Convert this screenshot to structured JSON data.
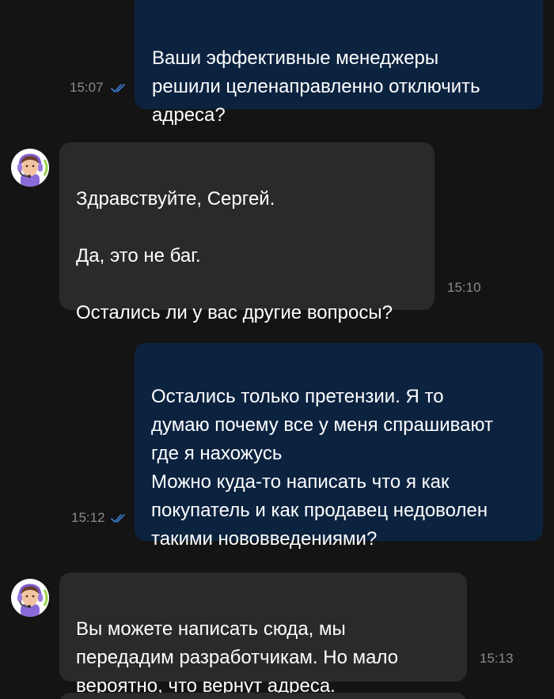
{
  "colors": {
    "background": "#141414",
    "outgoing_bubble": "#0c2340",
    "incoming_bubble": "#2a2a2a",
    "text": "#ffffff",
    "time": "#8a8a8a",
    "read_ticks": "#3d7fd6"
  },
  "messages": [
    {
      "direction": "outgoing",
      "text": "Ваши эффективные менеджеры\nрешили целенаправленно отключить\nадреса?",
      "time": "15:07",
      "status_icon": "double-check-icon"
    },
    {
      "direction": "incoming",
      "avatar_icon": "support-agent-avatar-icon",
      "text": "Здравствуйте, Сергей.\n\nДа, это не баг.\n\nОстались ли у вас другие вопросы?",
      "time": "15:10"
    },
    {
      "direction": "outgoing",
      "text": "Остались только претензии. Я то\nдумаю почему все у меня спрашивают\nгде я нахожусь\nМожно куда-то написать что я как\nпокупатель и как продавец недоволен\nтакими нововведениями?",
      "time": "15:12",
      "status_icon": "double-check-icon"
    },
    {
      "direction": "incoming",
      "avatar_icon": "support-agent-avatar-icon",
      "text": "Вы можете написать сюда, мы\nпередадим разработчикам. Но мало\nвероятно, что вернут адреса.",
      "time": "15:13"
    }
  ]
}
